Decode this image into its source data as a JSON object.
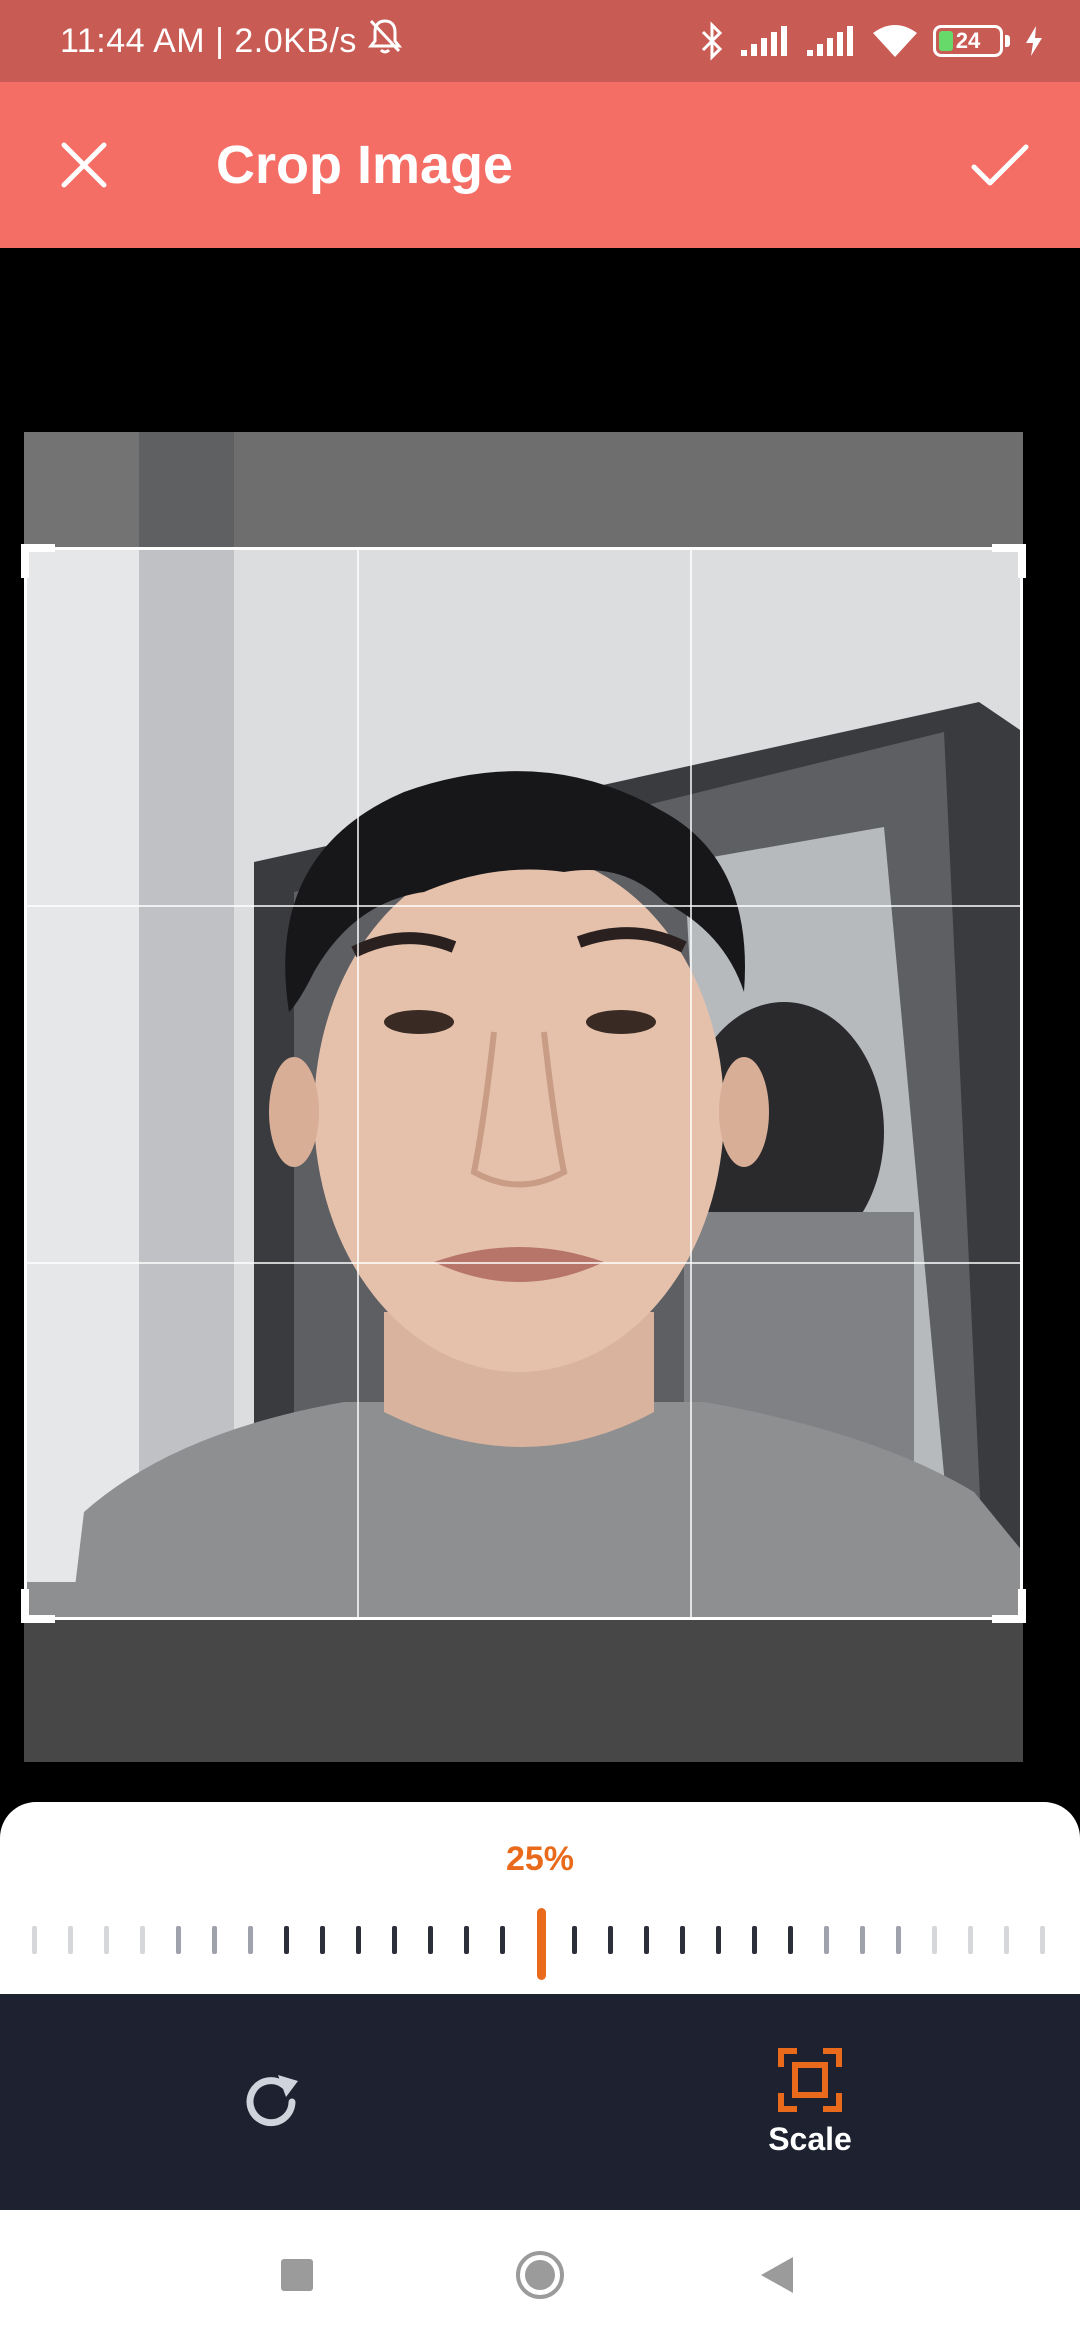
{
  "status_bar": {
    "time_and_speed": "11:44 AM | 2.0KB/s",
    "battery_level": "24",
    "icons": [
      "bell-off-icon",
      "bluetooth-icon",
      "signal-icon",
      "signal-icon",
      "wifi-icon",
      "battery-icon",
      "charging-icon"
    ]
  },
  "app_bar": {
    "title": "Crop Image",
    "close_icon": "close-icon",
    "done_icon": "check-icon",
    "color": "#F46E65"
  },
  "scale": {
    "value_label": "25%",
    "accent_color": "#E96A1A"
  },
  "tools": {
    "rotate": {
      "icon": "rotate-icon"
    },
    "scale": {
      "icon": "scale-icon",
      "label": "Scale",
      "active": true
    }
  },
  "nav_bar": {
    "icons": [
      "recents-square-icon",
      "home-circle-icon",
      "back-triangle-icon"
    ]
  }
}
